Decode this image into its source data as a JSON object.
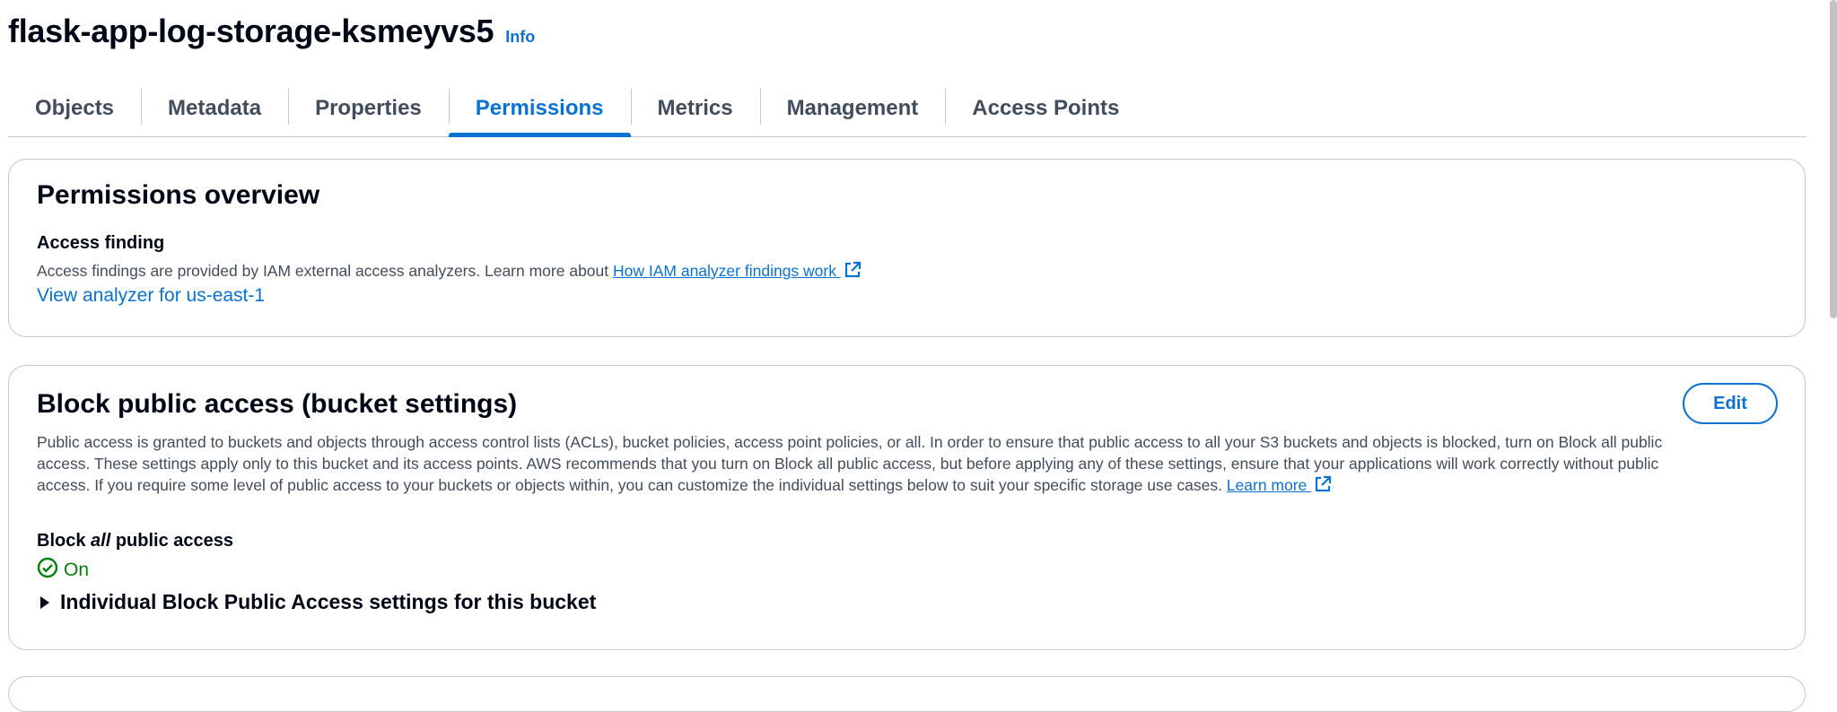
{
  "header": {
    "bucket_name": "flask-app-log-storage-ksmeyvs5",
    "info_label": "Info"
  },
  "tabs": [
    {
      "label": "Objects",
      "active": false
    },
    {
      "label": "Metadata",
      "active": false
    },
    {
      "label": "Properties",
      "active": false
    },
    {
      "label": "Permissions",
      "active": true
    },
    {
      "label": "Metrics",
      "active": false
    },
    {
      "label": "Management",
      "active": false
    },
    {
      "label": "Access Points",
      "active": false
    }
  ],
  "permissions_overview": {
    "title": "Permissions overview",
    "access_finding_heading": "Access finding",
    "description": "Access findings are provided by IAM external access analyzers. Learn more about ",
    "learn_link": "How IAM analyzer findings work ",
    "analyzer_link": "View analyzer for us-east-1"
  },
  "block_public_access": {
    "title": "Block public access (bucket settings)",
    "edit_label": "Edit",
    "description_lines": [
      "Public access is granted to buckets and objects through access control lists (ACLs), bucket policies, access point policies, or all. In order to ensure that public access to all your S3 buckets and objects is blocked, turn on Block all public",
      "access. These settings apply only to this bucket and its access points. AWS recommends that you turn on Block all public access, but before applying any of these settings, ensure that your applications will work correctly without public",
      "access. If you require some level of public access to your buckets or objects within, you can customize the individual settings below to suit your specific storage use cases. "
    ],
    "learn_more_link": "Learn more ",
    "block_all_prefix": "Block ",
    "block_all_emphasis": "all",
    "block_all_suffix": " public access",
    "status": "On",
    "individual_settings_label": "Individual Block Public Access settings for this bucket"
  },
  "colors": {
    "link": "#0972d3",
    "success": "#037f0c",
    "text": "#000716",
    "secondary_text": "#414d5c",
    "border": "#c6c6cd"
  },
  "icons": {
    "external_link": "external-link-icon",
    "status_success": "status-check-icon",
    "expand_caret": "caret-right-icon"
  }
}
